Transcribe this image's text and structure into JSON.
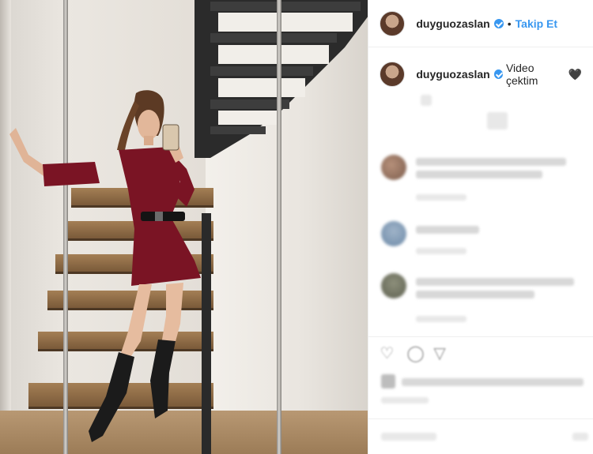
{
  "header": {
    "username": "duyguozaslan",
    "separator": "•",
    "follow_label": "Takip Et"
  },
  "caption": {
    "username": "duyguozaslan",
    "text": "Video çektim",
    "emoji": "🖤"
  },
  "icons": {
    "verified": "verified-badge-icon",
    "like": "heart-icon",
    "comment": "comment-icon",
    "share": "share-icon"
  },
  "colors": {
    "accent": "#3897f0",
    "dress": "#7a1424",
    "stairs": "#2b2b2b",
    "wood": "#8f6a44"
  }
}
